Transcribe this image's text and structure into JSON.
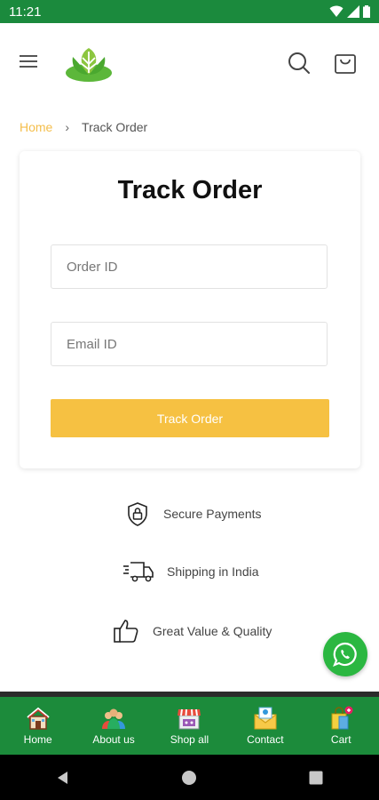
{
  "status_bar": {
    "time": "11:21"
  },
  "breadcrumb": {
    "home": "Home",
    "separator": "›",
    "current": "Track Order"
  },
  "form": {
    "title": "Track Order",
    "order_placeholder": "Order ID",
    "email_placeholder": "Email ID",
    "button_label": "Track Order"
  },
  "features": [
    {
      "label": "Secure Payments",
      "icon": "shield-lock-icon"
    },
    {
      "label": "Shipping in India",
      "icon": "delivery-truck-icon"
    },
    {
      "label": "Great Value & Quality",
      "icon": "thumbs-up-icon"
    }
  ],
  "bottom_nav": [
    {
      "label": "Home",
      "icon": "house-icon"
    },
    {
      "label": "About us",
      "icon": "people-icon"
    },
    {
      "label": "Shop all",
      "icon": "store-icon"
    },
    {
      "label": "Contact",
      "icon": "envelope-icon"
    },
    {
      "label": "Cart",
      "icon": "shopping-bag-icon"
    }
  ],
  "colors": {
    "brand_green": "#1c8b3b",
    "accent_yellow": "#f6c142",
    "breadcrumb_home": "#f4be4b",
    "whatsapp_green": "#2bb741"
  }
}
